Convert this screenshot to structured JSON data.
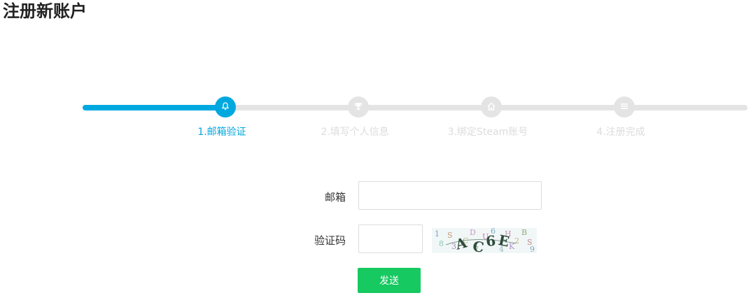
{
  "page": {
    "title": "注册新账户"
  },
  "progress": {
    "completed_fraction": 0.25,
    "accent_color": "#00a8e0",
    "inactive_color": "#e4e4e4",
    "steps": [
      {
        "label": "1.邮箱验证",
        "icon": "bell-icon",
        "active": true
      },
      {
        "label": "2.填写个人信息",
        "icon": "trophy-icon",
        "active": false
      },
      {
        "label": "3.绑定Steam账号",
        "icon": "home-icon",
        "active": false
      },
      {
        "label": "4.注册完成",
        "icon": "menu-icon",
        "active": false
      }
    ]
  },
  "form": {
    "email": {
      "label": "邮箱",
      "value": "",
      "placeholder": ""
    },
    "captcha": {
      "label": "验证码",
      "value": "",
      "placeholder": "",
      "image_text": "AC6E"
    },
    "send_label": "发送",
    "send_color": "#16c960"
  }
}
